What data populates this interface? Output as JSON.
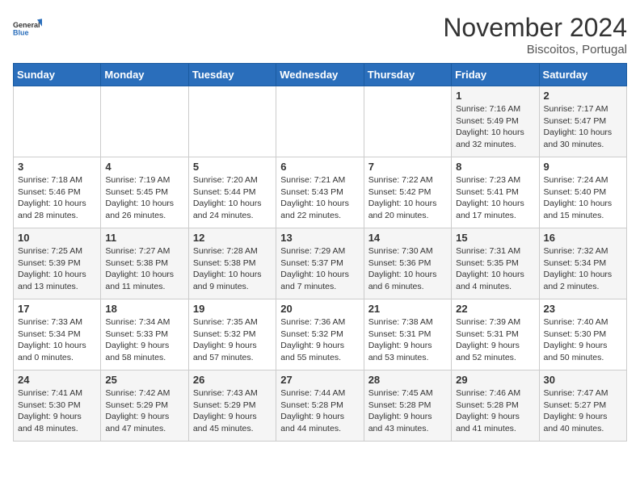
{
  "logo": {
    "general": "General",
    "blue": "Blue"
  },
  "header": {
    "month": "November 2024",
    "location": "Biscoitos, Portugal"
  },
  "weekdays": [
    "Sunday",
    "Monday",
    "Tuesday",
    "Wednesday",
    "Thursday",
    "Friday",
    "Saturday"
  ],
  "weeks": [
    [
      {
        "day": "",
        "info": ""
      },
      {
        "day": "",
        "info": ""
      },
      {
        "day": "",
        "info": ""
      },
      {
        "day": "",
        "info": ""
      },
      {
        "day": "",
        "info": ""
      },
      {
        "day": "1",
        "info": "Sunrise: 7:16 AM\nSunset: 5:49 PM\nDaylight: 10 hours\nand 32 minutes."
      },
      {
        "day": "2",
        "info": "Sunrise: 7:17 AM\nSunset: 5:47 PM\nDaylight: 10 hours\nand 30 minutes."
      }
    ],
    [
      {
        "day": "3",
        "info": "Sunrise: 7:18 AM\nSunset: 5:46 PM\nDaylight: 10 hours\nand 28 minutes."
      },
      {
        "day": "4",
        "info": "Sunrise: 7:19 AM\nSunset: 5:45 PM\nDaylight: 10 hours\nand 26 minutes."
      },
      {
        "day": "5",
        "info": "Sunrise: 7:20 AM\nSunset: 5:44 PM\nDaylight: 10 hours\nand 24 minutes."
      },
      {
        "day": "6",
        "info": "Sunrise: 7:21 AM\nSunset: 5:43 PM\nDaylight: 10 hours\nand 22 minutes."
      },
      {
        "day": "7",
        "info": "Sunrise: 7:22 AM\nSunset: 5:42 PM\nDaylight: 10 hours\nand 20 minutes."
      },
      {
        "day": "8",
        "info": "Sunrise: 7:23 AM\nSunset: 5:41 PM\nDaylight: 10 hours\nand 17 minutes."
      },
      {
        "day": "9",
        "info": "Sunrise: 7:24 AM\nSunset: 5:40 PM\nDaylight: 10 hours\nand 15 minutes."
      }
    ],
    [
      {
        "day": "10",
        "info": "Sunrise: 7:25 AM\nSunset: 5:39 PM\nDaylight: 10 hours\nand 13 minutes."
      },
      {
        "day": "11",
        "info": "Sunrise: 7:27 AM\nSunset: 5:38 PM\nDaylight: 10 hours\nand 11 minutes."
      },
      {
        "day": "12",
        "info": "Sunrise: 7:28 AM\nSunset: 5:38 PM\nDaylight: 10 hours\nand 9 minutes."
      },
      {
        "day": "13",
        "info": "Sunrise: 7:29 AM\nSunset: 5:37 PM\nDaylight: 10 hours\nand 7 minutes."
      },
      {
        "day": "14",
        "info": "Sunrise: 7:30 AM\nSunset: 5:36 PM\nDaylight: 10 hours\nand 6 minutes."
      },
      {
        "day": "15",
        "info": "Sunrise: 7:31 AM\nSunset: 5:35 PM\nDaylight: 10 hours\nand 4 minutes."
      },
      {
        "day": "16",
        "info": "Sunrise: 7:32 AM\nSunset: 5:34 PM\nDaylight: 10 hours\nand 2 minutes."
      }
    ],
    [
      {
        "day": "17",
        "info": "Sunrise: 7:33 AM\nSunset: 5:34 PM\nDaylight: 10 hours\nand 0 minutes."
      },
      {
        "day": "18",
        "info": "Sunrise: 7:34 AM\nSunset: 5:33 PM\nDaylight: 9 hours\nand 58 minutes."
      },
      {
        "day": "19",
        "info": "Sunrise: 7:35 AM\nSunset: 5:32 PM\nDaylight: 9 hours\nand 57 minutes."
      },
      {
        "day": "20",
        "info": "Sunrise: 7:36 AM\nSunset: 5:32 PM\nDaylight: 9 hours\nand 55 minutes."
      },
      {
        "day": "21",
        "info": "Sunrise: 7:38 AM\nSunset: 5:31 PM\nDaylight: 9 hours\nand 53 minutes."
      },
      {
        "day": "22",
        "info": "Sunrise: 7:39 AM\nSunset: 5:31 PM\nDaylight: 9 hours\nand 52 minutes."
      },
      {
        "day": "23",
        "info": "Sunrise: 7:40 AM\nSunset: 5:30 PM\nDaylight: 9 hours\nand 50 minutes."
      }
    ],
    [
      {
        "day": "24",
        "info": "Sunrise: 7:41 AM\nSunset: 5:30 PM\nDaylight: 9 hours\nand 48 minutes."
      },
      {
        "day": "25",
        "info": "Sunrise: 7:42 AM\nSunset: 5:29 PM\nDaylight: 9 hours\nand 47 minutes."
      },
      {
        "day": "26",
        "info": "Sunrise: 7:43 AM\nSunset: 5:29 PM\nDaylight: 9 hours\nand 45 minutes."
      },
      {
        "day": "27",
        "info": "Sunrise: 7:44 AM\nSunset: 5:28 PM\nDaylight: 9 hours\nand 44 minutes."
      },
      {
        "day": "28",
        "info": "Sunrise: 7:45 AM\nSunset: 5:28 PM\nDaylight: 9 hours\nand 43 minutes."
      },
      {
        "day": "29",
        "info": "Sunrise: 7:46 AM\nSunset: 5:28 PM\nDaylight: 9 hours\nand 41 minutes."
      },
      {
        "day": "30",
        "info": "Sunrise: 7:47 AM\nSunset: 5:27 PM\nDaylight: 9 hours\nand 40 minutes."
      }
    ]
  ]
}
